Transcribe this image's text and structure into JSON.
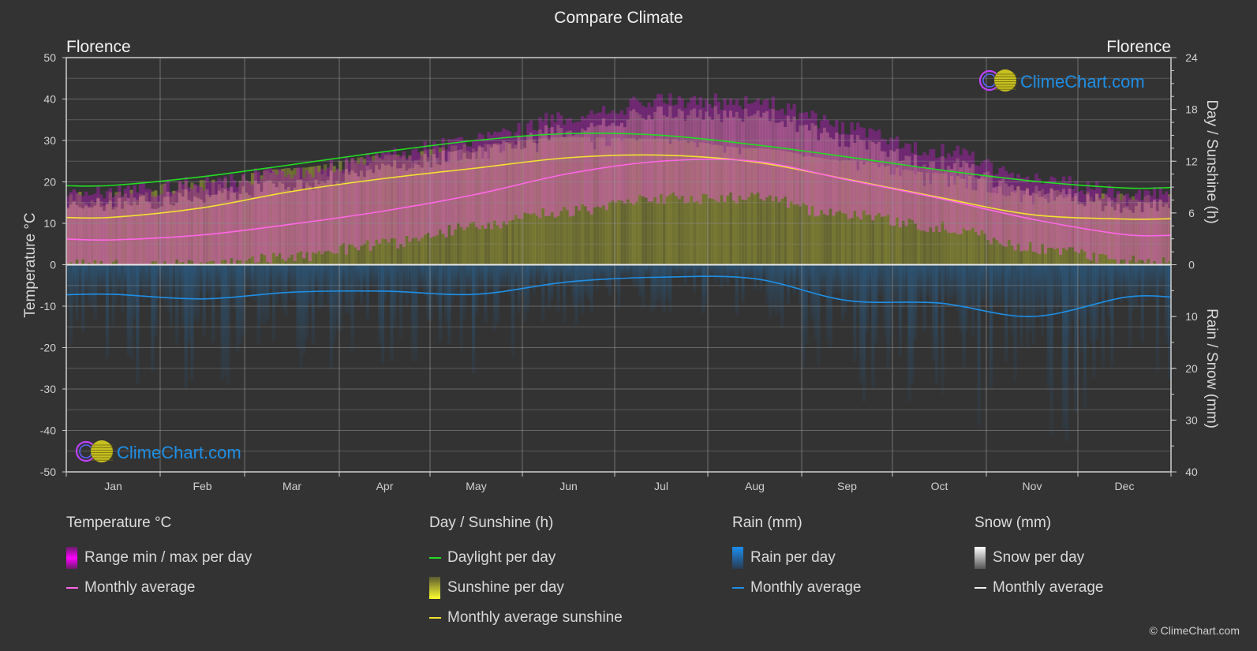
{
  "chart_data": {
    "type": "area",
    "title": "Compare Climate",
    "location_left": "Florence",
    "location_right": "Florence",
    "categories": [
      "Jan",
      "Feb",
      "Mar",
      "Apr",
      "May",
      "Jun",
      "Jul",
      "Aug",
      "Sep",
      "Oct",
      "Nov",
      "Dec"
    ],
    "left_axis": {
      "label": "Temperature °C",
      "range": [
        -50,
        50
      ],
      "ticks": [
        50,
        40,
        30,
        20,
        10,
        0,
        -10,
        -20,
        -30,
        -40,
        -50
      ]
    },
    "right_axis_top": {
      "label": "Day / Sunshine (h)",
      "range": [
        0,
        24
      ],
      "ticks": [
        24,
        18,
        12,
        6,
        0
      ]
    },
    "right_axis_bottom": {
      "label": "Rain / Snow (mm)",
      "range": [
        0,
        40
      ],
      "ticks": [
        0,
        10,
        20,
        30,
        40
      ]
    },
    "grid": true,
    "series": [
      {
        "name": "Daylight per day",
        "axis": "hours",
        "color": "#22dd22",
        "values": [
          9.2,
          10.2,
          11.6,
          13.1,
          14.4,
          15.2,
          15.0,
          13.9,
          12.5,
          11.0,
          9.7,
          8.9
        ]
      },
      {
        "name": "Monthly average sunshine",
        "axis": "hours",
        "color": "#f2e230",
        "values": [
          5.5,
          6.6,
          8.5,
          10.0,
          11.2,
          12.4,
          12.7,
          11.9,
          9.9,
          7.8,
          5.8,
          5.3
        ]
      },
      {
        "name": "Temperature monthly average",
        "axis": "temperature",
        "color": "#ff66e6",
        "values": [
          6.0,
          7.2,
          9.8,
          13.0,
          17.0,
          22.0,
          25.0,
          25.0,
          20.5,
          16.0,
          11.0,
          7.3
        ]
      },
      {
        "name": "Rain monthly average",
        "axis": "rain",
        "color": "#1e8fe6",
        "values": [
          5.7,
          6.6,
          5.3,
          5.1,
          5.7,
          3.3,
          2.4,
          2.7,
          6.9,
          7.4,
          10.0,
          6.3
        ]
      },
      {
        "name": "Temperature range max per day (approx)",
        "axis": "temperature",
        "color": "#c020c0",
        "values": [
          14,
          16,
          19,
          23,
          27,
          32,
          36,
          36,
          30,
          24,
          18,
          14
        ]
      },
      {
        "name": "Temperature range min per day (approx)",
        "axis": "temperature",
        "color": "#c020c0",
        "values": [
          0,
          0,
          2,
          5,
          9,
          13,
          16,
          16,
          12,
          9,
          4,
          1
        ]
      }
    ]
  },
  "watermark": "ClimeChart.com",
  "legend": {
    "groups": [
      {
        "title": "Temperature °C",
        "items": [
          {
            "label": "Range min / max per day",
            "kind": "box",
            "color": "#e020e0"
          },
          {
            "label": "Monthly average",
            "kind": "line",
            "color": "#ff66e6"
          }
        ]
      },
      {
        "title": "Day / Sunshine (h)",
        "items": [
          {
            "label": "Daylight per day",
            "kind": "line",
            "color": "#22dd22"
          },
          {
            "label": "Sunshine per day",
            "kind": "box",
            "color": "#f2ec30"
          },
          {
            "label": "Monthly average sunshine",
            "kind": "line",
            "color": "#f2e230"
          }
        ]
      },
      {
        "title": "Rain (mm)",
        "items": [
          {
            "label": "Rain per day",
            "kind": "box",
            "color": "#1a8ef0"
          },
          {
            "label": "Monthly average",
            "kind": "line",
            "color": "#1e8fe6"
          }
        ]
      },
      {
        "title": "Snow (mm)",
        "items": [
          {
            "label": "Snow per day",
            "kind": "box",
            "color": "#f0f0f0"
          },
          {
            "label": "Monthly average",
            "kind": "line",
            "color": "#f0f0f0"
          }
        ]
      }
    ]
  },
  "copyright": "© ClimeChart.com"
}
